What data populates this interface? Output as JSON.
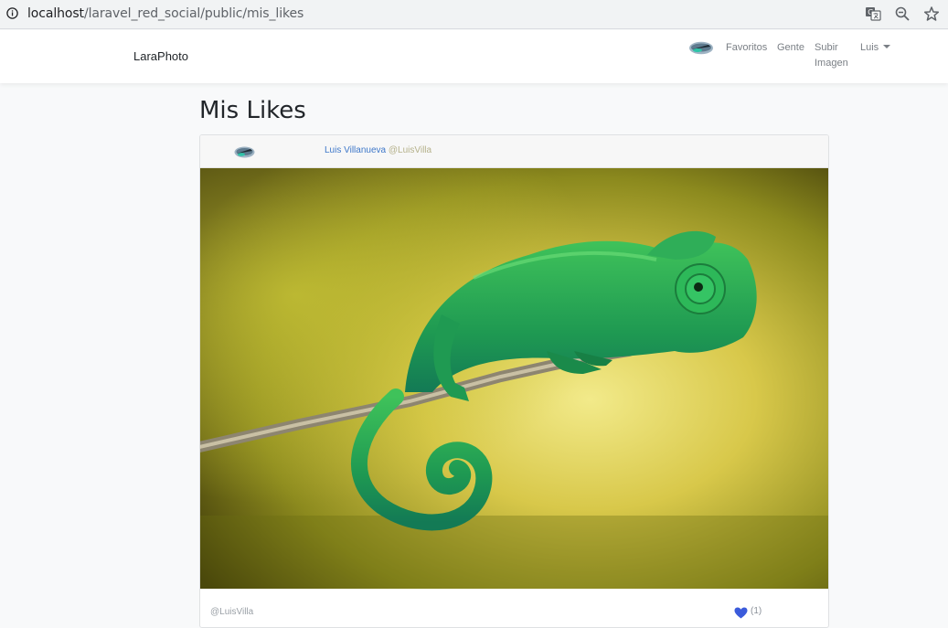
{
  "browser": {
    "url_host": "localhost",
    "url_path": "/laravel_red_social/public/mis_likes",
    "icons": [
      "info-icon",
      "translate-icon",
      "zoom-icon",
      "star-icon"
    ]
  },
  "navbar": {
    "brand": "LaraPhoto",
    "links": {
      "favoritos": "Favoritos",
      "gente": "Gente",
      "subir_1": "Subir",
      "subir_2": "Imagen",
      "user": "Luis"
    }
  },
  "main": {
    "title": "Mis Likes",
    "post": {
      "author_name": "Luis Villanueva",
      "author_nick": "@LuisVilla",
      "footer_nick": "@LuisVilla",
      "likes": "(1)",
      "image_subject": "green chameleon on a branch",
      "heart_color": "#3b5bdb"
    }
  }
}
